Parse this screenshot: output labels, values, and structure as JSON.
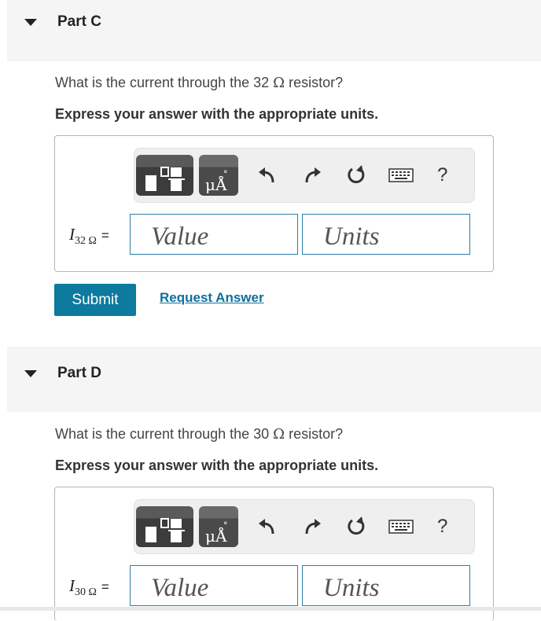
{
  "parts": [
    {
      "title": "Part C",
      "question_before": "What is the current through the 32 ",
      "question_after": " resistor?",
      "omega": "Ω",
      "instruction": "Express your answer with the appropriate units.",
      "variable": "I",
      "variable_sub": "32 Ω",
      "equals": "=",
      "value_placeholder": "Value",
      "units_placeholder": "Units",
      "help": "?",
      "units_button_glyph_top": "°",
      "units_button_glyph": "μÅ"
    },
    {
      "title": "Part D",
      "question_before": "What is the current through the 30 ",
      "question_after": " resistor?",
      "omega": "Ω",
      "instruction": "Express your answer with the appropriate units.",
      "variable": "I",
      "variable_sub": "30 Ω",
      "equals": "=",
      "value_placeholder": "Value",
      "units_placeholder": "Units",
      "help": "?",
      "units_button_glyph_top": "°",
      "units_button_glyph": "μÅ"
    }
  ],
  "actions": {
    "submit_label": "Submit",
    "request_label": "Request Answer"
  },
  "icons": {
    "collapse": "caret-down-icon",
    "templates": "templates-icon",
    "units": "units-icon",
    "undo": "undo-icon",
    "redo": "redo-icon",
    "reset": "reset-icon",
    "keyboard": "keyboard-icon",
    "help": "help-icon"
  },
  "colors": {
    "accent": "#0d7a9e",
    "field_border": "#2b7fa6",
    "header_bg": "#f5f5f5"
  }
}
